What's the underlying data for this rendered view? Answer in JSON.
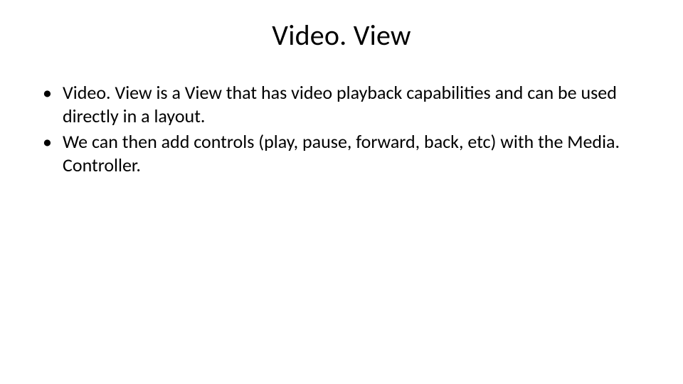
{
  "title": "Video. View",
  "bullets": [
    "Video. View is a View that has video playback capabilities and can be used directly in a layout.",
    "We can then add controls (play, pause, forward, back, etc) with the Media. Controller."
  ]
}
